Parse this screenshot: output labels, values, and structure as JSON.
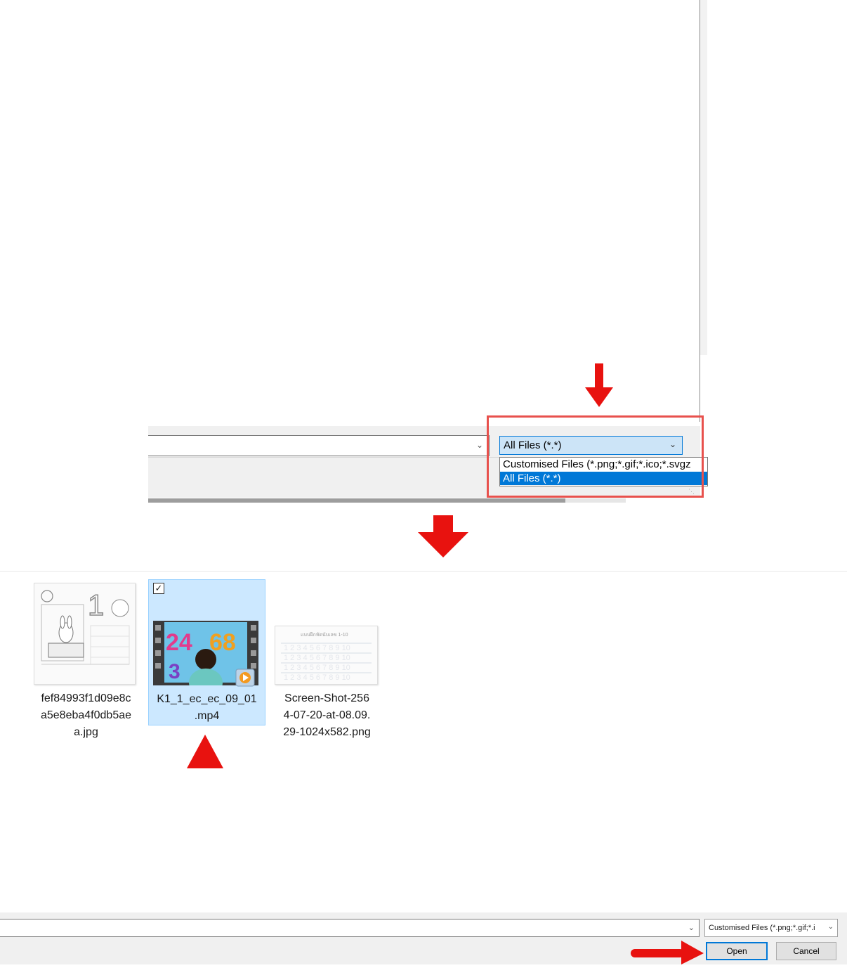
{
  "top_dialog": {
    "file_type_selected": "All Files (*.*)",
    "file_type_options": [
      "Customised Files (*.png;*.gif;*.ico;*.svgz",
      "All Files (*.*)"
    ],
    "selected_option_index": 1
  },
  "files": [
    {
      "name_lines": [
        "fef84993f1d09e8c",
        "a5e8eba4f0db5ae",
        "a.jpg"
      ],
      "type": "image",
      "selected": false
    },
    {
      "name_lines": [
        "K1_1_ec_ec_09_01",
        ".mp4"
      ],
      "type": "video",
      "selected": true
    },
    {
      "name_lines": [
        "Screen-Shot-256",
        "4-07-20-at-08.09.",
        "29-1024x582.png"
      ],
      "type": "image",
      "selected": false
    }
  ],
  "bottom_dialog": {
    "file_type_selected": "Customised Files (*.png;*.gif;*.i",
    "open_label": "Open",
    "cancel_label": "Cancel"
  },
  "colors": {
    "annotation": "#e8120f",
    "selection": "#0078d7",
    "selected_tile": "#cce8ff"
  },
  "icons": {
    "chevron": "chevron-down-icon",
    "arrow_down": "red-arrow-down-icon",
    "arrow_right": "red-arrow-right-icon",
    "triangle_up": "red-triangle-up-icon",
    "checkbox": "checkbox-checked-icon",
    "video_overlay": "media-play-icon"
  }
}
